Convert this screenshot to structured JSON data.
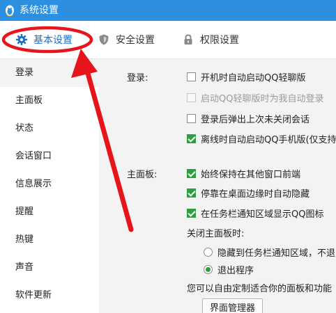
{
  "window": {
    "title": "系统设置"
  },
  "tabs": [
    {
      "label": "基本设置"
    },
    {
      "label": "安全设置"
    },
    {
      "label": "权限设置"
    }
  ],
  "sidebar": {
    "items": [
      {
        "label": "登录"
      },
      {
        "label": "主面板"
      },
      {
        "label": "状态"
      },
      {
        "label": "会话窗口"
      },
      {
        "label": "信息展示"
      },
      {
        "label": "提醒"
      },
      {
        "label": "热键"
      },
      {
        "label": "声音"
      },
      {
        "label": "软件更新"
      }
    ]
  },
  "login": {
    "label": "登录:",
    "options": [
      {
        "label": "开机时自动启动QQ轻聊版",
        "checked": false,
        "disabled": false
      },
      {
        "label": "启动QQ轻聊版时为我自动登录",
        "checked": false,
        "disabled": true
      },
      {
        "label": "登录后弹出上次未关闭会话",
        "checked": false,
        "disabled": false
      },
      {
        "label": "离线时自动启动QQ手机版(仅支持",
        "checked": true,
        "disabled": false
      }
    ]
  },
  "main_panel": {
    "label": "主面板:",
    "options": [
      {
        "label": "始终保持在其他窗口前端",
        "checked": true
      },
      {
        "label": "停靠在桌面边缘时自动隐藏",
        "checked": true
      },
      {
        "label": "在任务栏通知区域显示QQ图标",
        "checked": true
      }
    ],
    "close_label": "关闭主面板时:",
    "close_options": [
      {
        "label": "隐藏到任务栏通知区域，不退",
        "selected": false
      },
      {
        "label": "退出程序",
        "selected": true
      }
    ],
    "note": "您可以自由定制适合你的面板和功能",
    "manager_button": "界面管理器"
  },
  "colors": {
    "titlebar": "#2d8fe0",
    "active_tab": "#1a6fc9",
    "checkbox_checked": "#2e9e3e",
    "annotation": "#e8141c"
  },
  "icons": {
    "window": "qq-penguin-icon",
    "tab_basic": "gear-icon",
    "tab_security": "shield-icon",
    "tab_permission": "lock-icon"
  }
}
